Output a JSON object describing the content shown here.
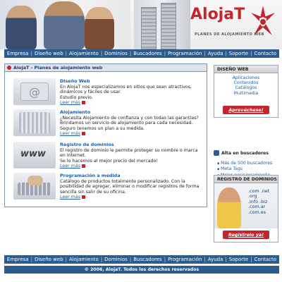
{
  "header": {
    "logo_title": "AlojaT",
    "logo_subtitle": "PLANES DE ALOJAMIENTO WEB"
  },
  "nav": {
    "items": [
      "Empresa",
      "Diseño web",
      "Alojamiento",
      "Dominios",
      "Buscadores",
      "Programación",
      "Ayuda",
      "Soporte",
      "Contacto"
    ]
  },
  "main": {
    "title": "AlojaT - Planes de alojamiento web",
    "services": [
      {
        "title": "Diseño Web",
        "desc": "En AlojaT nos especializamos en sitios que sean atractivos, dinámicos y fáciles de usar.\nEstudio previo.",
        "more": "Leer más"
      },
      {
        "title": "Alojamiento",
        "desc": "¿Necesita Alojamiento de confianza y con todas las garantías?\nBrindamos un servicio de alojamiento para cada necesidad.\nSeguro tenemos un plan a su medida.",
        "more": "Leer más"
      },
      {
        "title": "Registro de dominios",
        "desc": "El registro de dominio le permite proteger su nombre o marca en Internet.\nSe lo hacemos al mejor precio del mercado!",
        "more": "Leer más"
      },
      {
        "title": "Programación a medida",
        "desc": "Catálogo de productos totalmente personalizado. Con la posibilidad de agregar, eliminar o modificar registros de forma sencilla sin salir de su oficina.",
        "more": "Leer más"
      }
    ]
  },
  "sidebar": {
    "diseno": {
      "title": "DISEÑO WEB",
      "items": [
        "Aplicaciones",
        "Contenidos",
        "Catálogos",
        "Multimedia"
      ],
      "cta": "Aprovéchese!"
    },
    "buscadores": {
      "title": "Alta en buscadores",
      "items": [
        "Más de 500 buscadores",
        "Meta Tags",
        "Mejor posicionamiento"
      ]
    },
    "dominios": {
      "title": "REGISTRO DE DOMINIOS",
      "items": [
        ".com .net .org",
        ".info .biz",
        ".com.ar",
        ".com.es"
      ],
      "cta": "Registrelo ya!"
    }
  },
  "footer": {
    "copyright": "© 2006, AlojaT. Todos los derechos reservados"
  },
  "colors": {
    "brand_red": "#c2252b",
    "nav_blue": "#2c5b8d",
    "link_blue": "#1e5fa8"
  }
}
